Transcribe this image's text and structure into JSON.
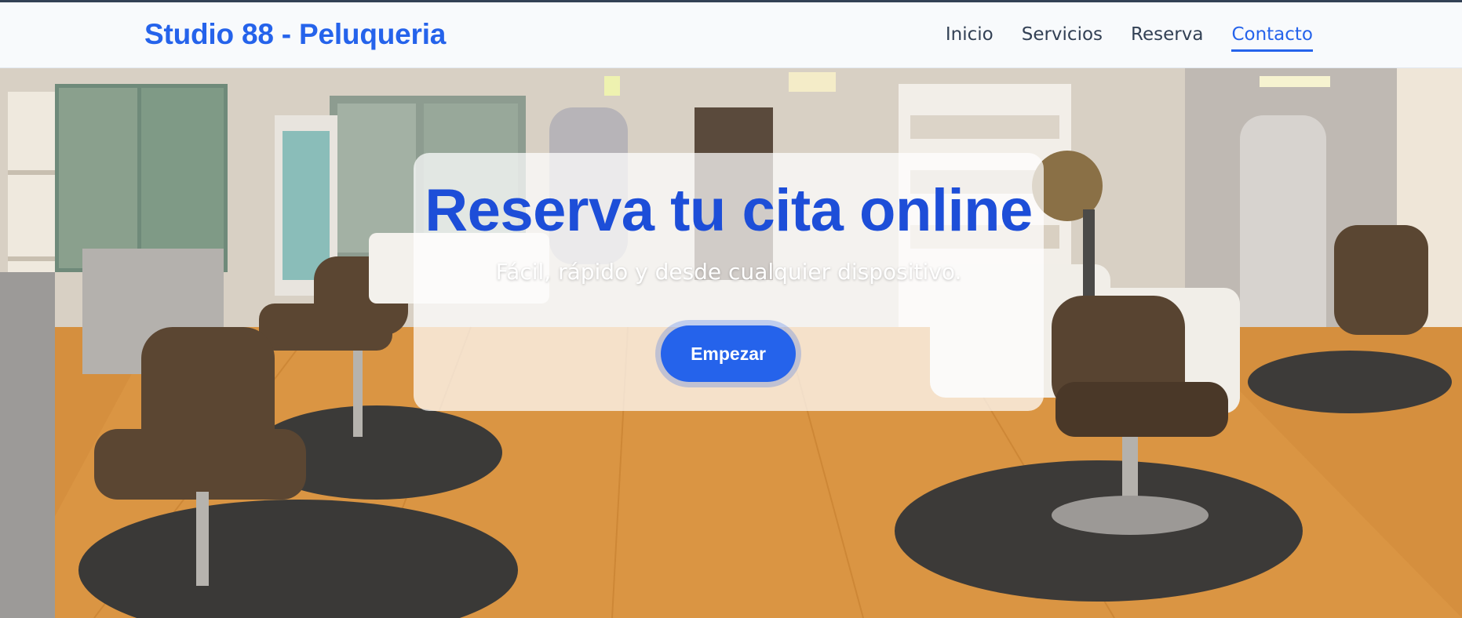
{
  "header": {
    "brand": "Studio 88 - Peluqueria",
    "nav": [
      {
        "label": "Inicio",
        "active": false
      },
      {
        "label": "Servicios",
        "active": false
      },
      {
        "label": "Reserva",
        "active": false
      },
      {
        "label": "Contacto",
        "active": true
      }
    ]
  },
  "hero": {
    "title": "Reserva tu cita online",
    "subtitle": "Fácil, rápido y desde cualquier dispositivo.",
    "cta_label": "Empezar",
    "background_image": "salon-interior-photo"
  },
  "colors": {
    "accent": "#2563eb",
    "title": "#1d4ed8",
    "nav_text": "#334155",
    "header_bg": "#f8fafc"
  }
}
